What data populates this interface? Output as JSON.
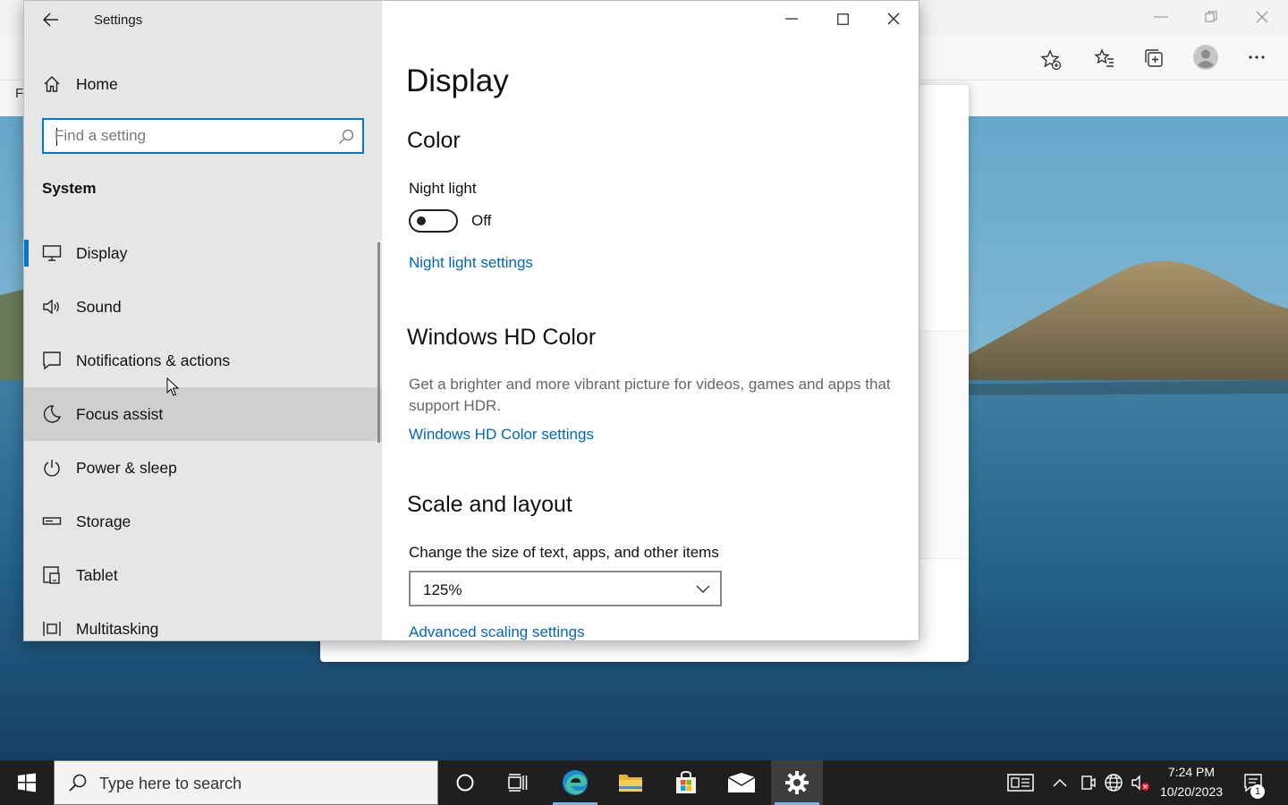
{
  "settings_window": {
    "title": "Settings",
    "search": {
      "placeholder": "Find a setting",
      "value": ""
    },
    "home_label": "Home",
    "group_label": "System",
    "nav_items": [
      {
        "label": "Display",
        "icon": "monitor-icon",
        "selected": true
      },
      {
        "label": "Sound",
        "icon": "speaker-icon"
      },
      {
        "label": "Notifications & actions",
        "icon": "notification-icon"
      },
      {
        "label": "Focus assist",
        "icon": "moon-icon",
        "hovered": true
      },
      {
        "label": "Power & sleep",
        "icon": "power-icon"
      },
      {
        "label": "Storage",
        "icon": "storage-icon"
      },
      {
        "label": "Tablet",
        "icon": "tablet-icon"
      },
      {
        "label": "Multitasking",
        "icon": "multitasking-icon"
      }
    ]
  },
  "content": {
    "page_title": "Display",
    "color": {
      "title": "Color",
      "night_light_label": "Night light",
      "night_light_state": "Off",
      "night_light_on": false,
      "night_light_link": "Night light settings"
    },
    "hd_color": {
      "title": "Windows HD Color",
      "description": "Get a brighter and more vibrant picture for videos, games and apps that support HDR.",
      "link": "Windows HD Color settings"
    },
    "scale": {
      "title": "Scale and layout",
      "label": "Change the size of text, apps, and other items",
      "value": "125%",
      "link": "Advanced scaling settings"
    }
  },
  "browser": {
    "partial_label": "F"
  },
  "taskbar": {
    "search_placeholder": "Type here to search",
    "time": "7:24 PM",
    "date": "10/20/2023",
    "notification_count": "1"
  },
  "colors": {
    "accent": "#0078d4",
    "link": "#0067c0",
    "taskbar": "#1f1f1f"
  }
}
